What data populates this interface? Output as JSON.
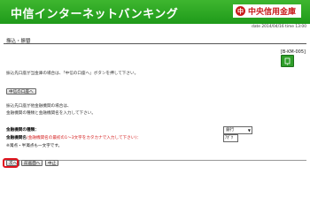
{
  "header": {
    "title": "中信インターネットバンキング",
    "bank_name": "中央信用金庫",
    "bank_mark": "中",
    "date_line": "date 2014/04/16 time 13:00"
  },
  "page": {
    "section_title": "振込・振替",
    "screen_code": "[B-KM-005]",
    "help_icon": "help-icon"
  },
  "content": {
    "para1": "振込先口座が当金庫の場合は、「中信の口座へ」ボタンを押して下さい。",
    "chushin_button": "中信の口座へ",
    "para2_line1": "振込先口座が他金融機関の場合は、",
    "para2_line2": "金融機関の種類と金融機関名を入力して下さい。"
  },
  "form": {
    "type_label": "金融機関の種類：",
    "type_value": "銀行",
    "name_label": "金融機関名",
    "name_note": "(金融機関名の最初の1～3文字をカタカナで入力して下さい)：",
    "name_value": "ｱｵﾞｸ",
    "footnote": "※濁点・半濁点も一文字です。"
  },
  "buttons": {
    "next": "次へ",
    "back": "前画面へ",
    "cancel": "中止"
  },
  "colors": {
    "header_green": "#2aa826",
    "bank_red": "#c81a1a",
    "highlight_red": "#e0141e"
  }
}
